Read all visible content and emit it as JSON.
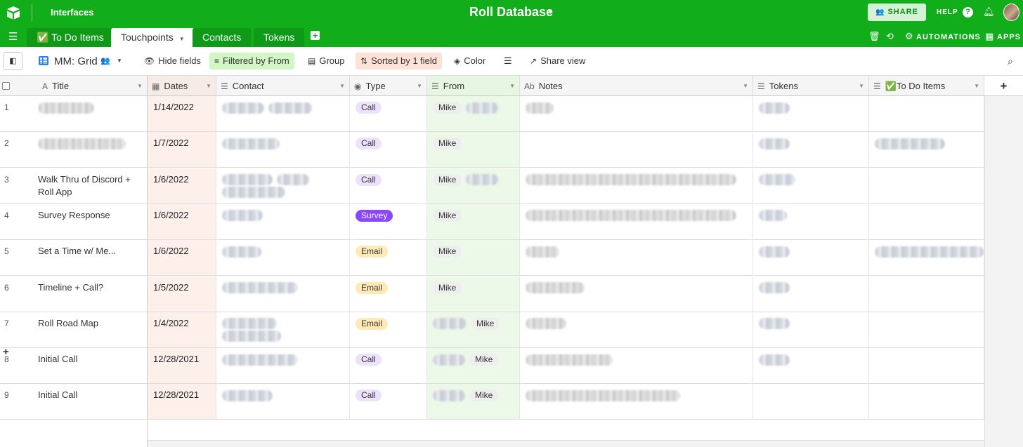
{
  "header": {
    "interfaces_label": "Interfaces",
    "db_title": "Roll Database",
    "share_label": "SHARE",
    "help_label": "HELP",
    "help_icon_text": "?"
  },
  "tabs": [
    {
      "label": "✅ To Do Items"
    },
    {
      "label": "Touchpoints",
      "active": true
    },
    {
      "label": "Contacts"
    },
    {
      "label": "Tokens"
    }
  ],
  "tabbar_right": {
    "automations_label": "AUTOMATIONS",
    "apps_label": "APPS"
  },
  "viewbar": {
    "view_name": "MM: Grid",
    "hide_fields": "Hide fields",
    "filter": "Filtered by From",
    "group": "Group",
    "sort": "Sorted by 1 field",
    "color": "Color",
    "share_view": "Share view"
  },
  "columns": [
    "Title",
    "Dates",
    "Contact",
    "Type",
    "From",
    "Notes",
    "Tokens",
    "✅To Do Items"
  ],
  "rows": [
    {
      "num": "1",
      "title": "",
      "date": "1/14/2022",
      "type": "Call",
      "from": "Mike"
    },
    {
      "num": "2",
      "title": "",
      "date": "1/7/2022",
      "type": "Call",
      "from": "Mike"
    },
    {
      "num": "3",
      "title": "Walk Thru of Discord + Roll App",
      "date": "1/6/2022",
      "type": "Call",
      "from": "Mike"
    },
    {
      "num": "4",
      "title": "Survey Response",
      "date": "1/6/2022",
      "type": "Survey",
      "from": "Mike"
    },
    {
      "num": "5",
      "title": "Set a Time w/ Me...",
      "date": "1/6/2022",
      "type": "Email",
      "from": "Mike"
    },
    {
      "num": "6",
      "title": "Timeline + Call?",
      "date": "1/5/2022",
      "type": "Email",
      "from": "Mike"
    },
    {
      "num": "7",
      "title": "Roll Road Map",
      "date": "1/4/2022",
      "type": "Email",
      "from": "Mike"
    },
    {
      "num": "8",
      "title": "Initial Call",
      "date": "12/28/2021",
      "type": "Call",
      "from": "Mike"
    },
    {
      "num": "9",
      "title": "Initial Call",
      "date": "12/28/2021",
      "type": "Call",
      "from": "Mike"
    }
  ],
  "type_colors": {
    "Call": "#ede2fe",
    "Survey": "#8b46ff",
    "Email": "#ffeab6"
  },
  "accent": "#11ad1b",
  "icons": [
    "logo-icon",
    "user-plus-icon",
    "help-icon",
    "bell-icon",
    "menu-icon",
    "add-table-icon",
    "trash-icon",
    "history-icon",
    "automations-icon",
    "apps-icon",
    "sidebar-toggle-icon",
    "grid-view-icon",
    "collaborators-icon",
    "hide-fields-icon",
    "filter-icon",
    "group-icon",
    "sort-icon",
    "color-icon",
    "row-height-icon",
    "share-view-icon",
    "search-icon"
  ]
}
